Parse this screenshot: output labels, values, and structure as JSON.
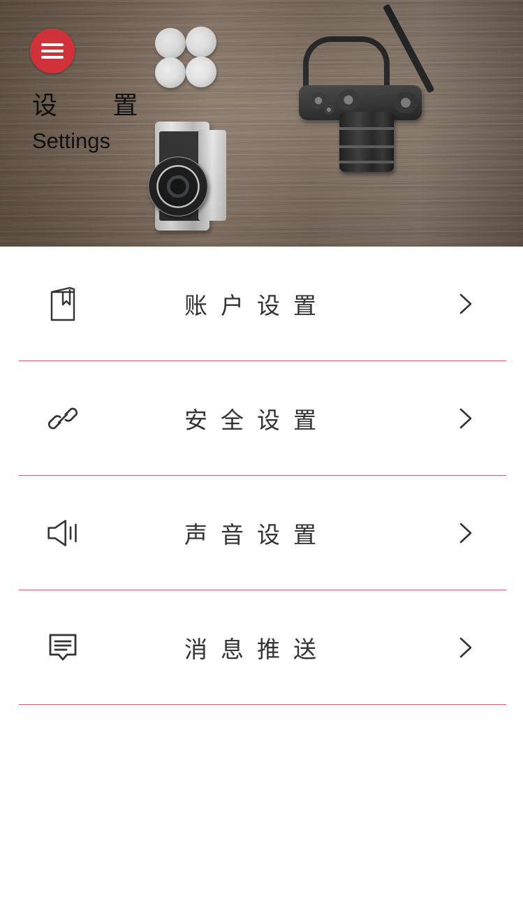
{
  "header": {
    "title_cn": "设 置",
    "title_en": "Settings",
    "menu_icon": "hamburger-menu-icon",
    "accent_color": "#d0323a"
  },
  "settings": {
    "items": [
      {
        "label": "账户设置",
        "icon": "book-bookmark-icon"
      },
      {
        "label": "安全设置",
        "icon": "link-icon"
      },
      {
        "label": "声音设置",
        "icon": "speaker-icon"
      },
      {
        "label": "消息推送",
        "icon": "message-icon"
      }
    ],
    "chevron_icon": "chevron-right-icon",
    "divider_color": "#d5616a"
  }
}
